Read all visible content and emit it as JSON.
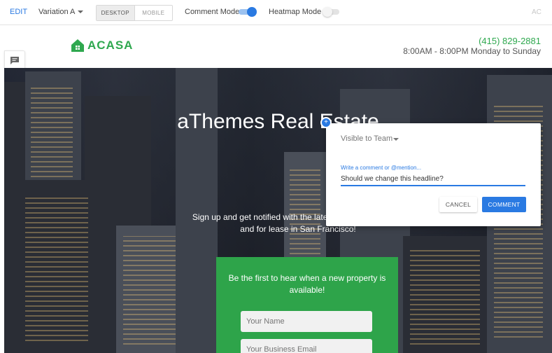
{
  "toolbar": {
    "edit_label": "EDIT",
    "variation_label": "Variation A",
    "device_desktop": "DESKTOP",
    "device_mobile": "MOBILE",
    "comment_mode_label": "Comment Mode",
    "comment_mode_on": true,
    "heatmap_mode_label": "Heatmap Mode",
    "heatmap_mode_on": false,
    "right_text": "AC"
  },
  "site": {
    "logo_text": "ACASA",
    "phone": "(415) 829-2881",
    "hours": "8:00AM - 8:00PM Monday to Sunday"
  },
  "hero": {
    "title": "aThemes Real Estate",
    "subtitle": "Sign up and get notified with the latest properties for sale and for lease in San Francisco!",
    "signup_title": "Be the first to hear when a new property is available!",
    "name_placeholder": "Your Name",
    "email_placeholder": "Your Business Email"
  },
  "comment_popup": {
    "visibility": "Visible to Team",
    "input_label": "Write a comment or @mention...",
    "input_value": "Should we change this headline?",
    "cancel_label": "CANCEL",
    "submit_label": "COMMENT"
  },
  "colors": {
    "accent": "#2a7ae2",
    "brand_green": "#2fa84f",
    "signup_green": "#2ea44a"
  },
  "icons": {
    "side_comment": "comment-icon",
    "pin": "plus-icon"
  }
}
